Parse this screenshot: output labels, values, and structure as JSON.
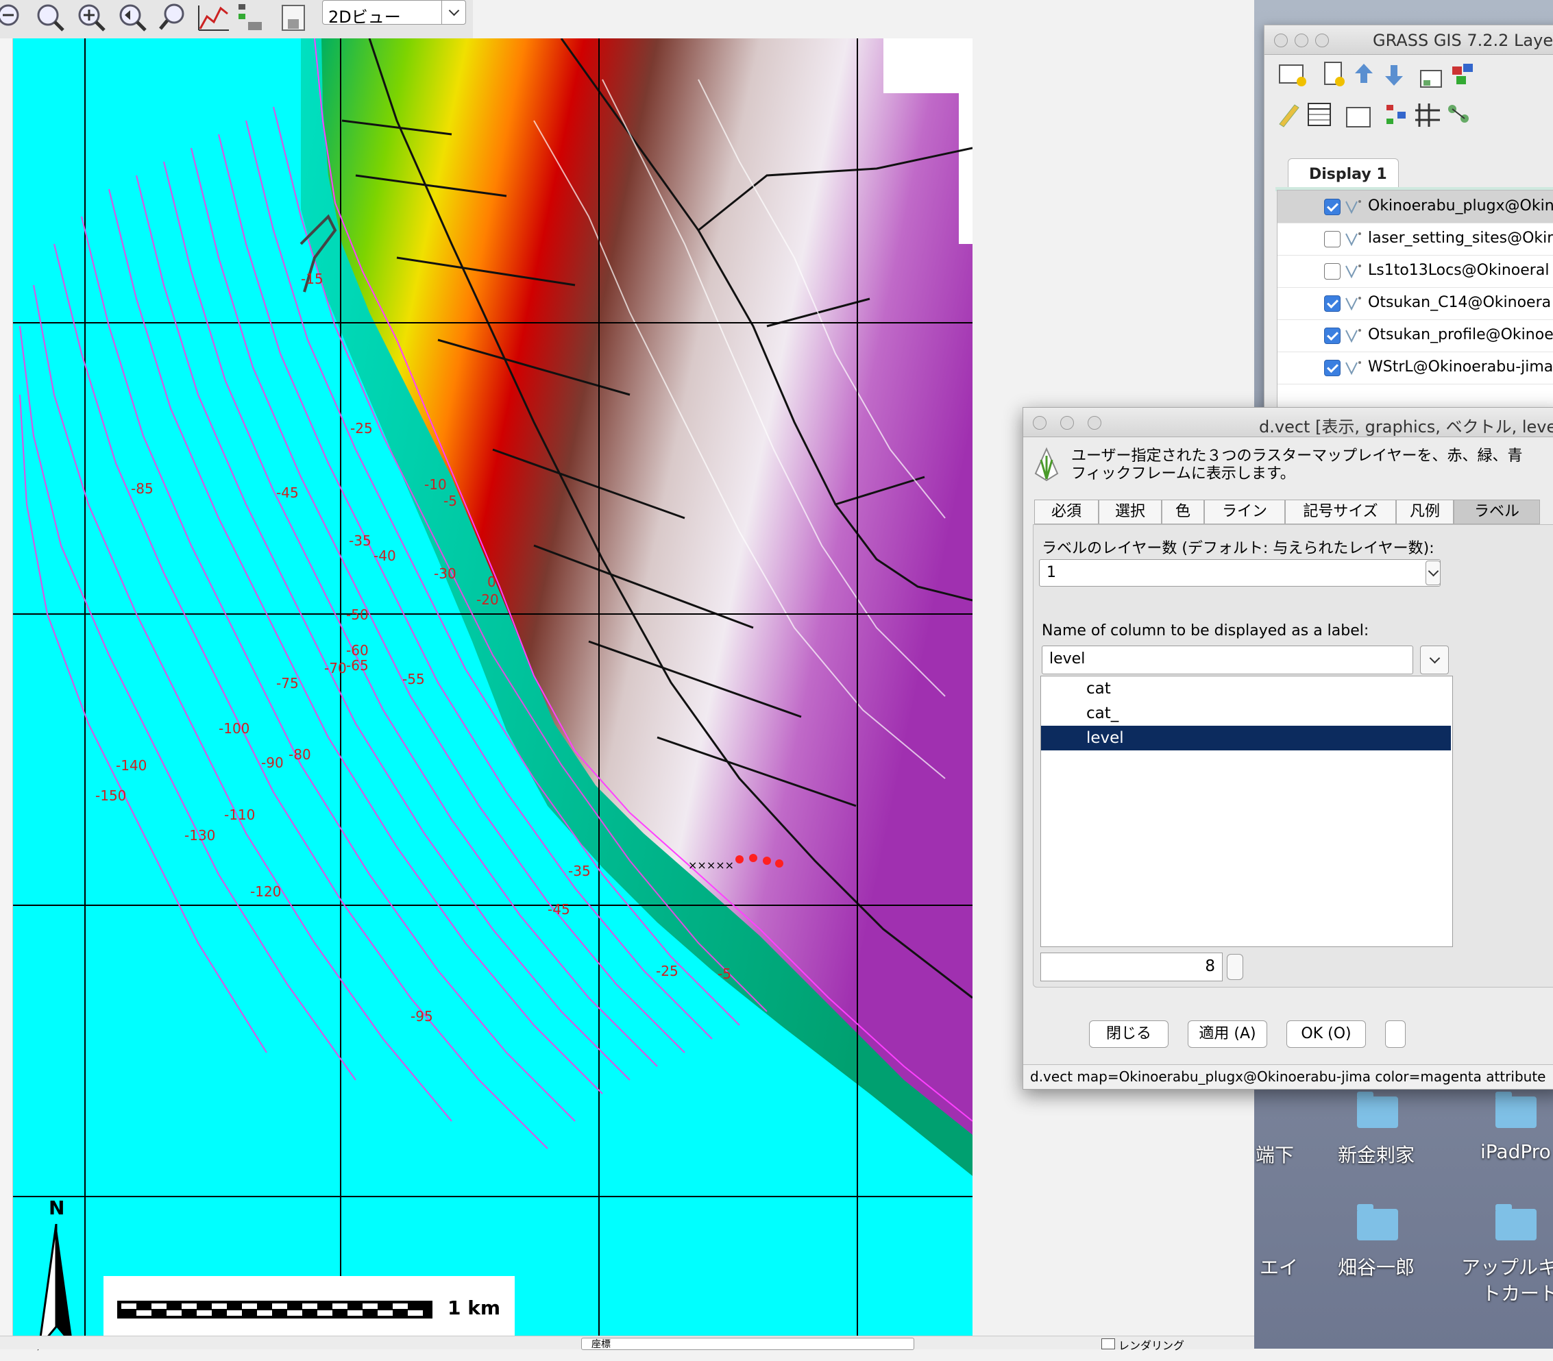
{
  "toolbar": {
    "icons": [
      "zoom-out-icon",
      "zoom-extent-icon",
      "zoom-in-icon",
      "zoom-back-icon",
      "zoom-region-icon",
      "profile-icon",
      "analyze-icon",
      "save-display-icon"
    ],
    "view_mode": "2Dビュー"
  },
  "map": {
    "north_label": "N",
    "scale_label": "1 km",
    "depth_labels": [
      "-15",
      "-25",
      "-10",
      "-5",
      "-85",
      "-45",
      "-35",
      "0",
      "-40",
      "-30",
      "-20",
      "-50",
      "-60",
      "-65",
      "-70",
      "-55",
      "-75",
      "-100",
      "-80",
      "-90",
      "-140",
      "-150",
      "-110",
      "-130",
      "-35",
      "-120",
      "-45",
      "-25",
      "-5",
      "-95"
    ],
    "colors": {
      "sea": "#00ffff",
      "contour": "#e050e0",
      "label": "#cc2222",
      "grid": "#000000"
    }
  },
  "status": {
    "coord_label": "座標",
    "render_label": "レンダリング"
  },
  "layer_manager": {
    "title": "GRASS GIS 7.2.2 Laye",
    "tab": "Display 1",
    "layers": [
      {
        "name": "Okinoerabu_plugx@Okin",
        "checked": true
      },
      {
        "name": "laser_setting_sites@Okin",
        "checked": false
      },
      {
        "name": "Ls1to13Locs@Okinoeral",
        "checked": false
      },
      {
        "name": "Otsukan_C14@Okinoera",
        "checked": true
      },
      {
        "name": "Otsukan_profile@Okinoe",
        "checked": true
      },
      {
        "name": "WStrL@Okinoerabu-jima",
        "checked": true
      }
    ]
  },
  "dvect": {
    "title": "d.vect [表示, graphics, ベクトル, leve",
    "description_line1": "ユーザー指定された３つのラスターマップレイヤーを、赤、緑、青",
    "description_line2": "フィックフレームに表示します。",
    "tabs": [
      "必須",
      "選択",
      "色",
      "ライン",
      "記号サイズ",
      "凡例",
      "ラベル"
    ],
    "layer_label": "ラベルのレイヤー数 (デフォルト: 与えられたレイヤー数):",
    "layer_value": "1",
    "column_label": "Name of column to be displayed as a label:",
    "column_value": "level",
    "columns": [
      "cat",
      "cat_",
      "level"
    ],
    "size_value": "8",
    "buttons": {
      "close": "閉じる",
      "apply": "適用 (A)",
      "ok": "OK (O)"
    },
    "command": "d.vect map=Okinoerabu_plugx@Okinoerabu-jima color=magenta attribute"
  },
  "desktop": {
    "items": [
      "端下",
      "新金剌家",
      "iPadPro",
      "エイ",
      "畑谷一郎",
      "アップルキ",
      "トカート"
    ]
  }
}
